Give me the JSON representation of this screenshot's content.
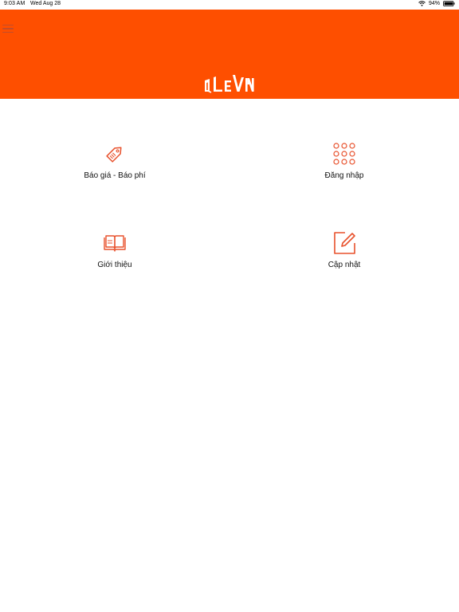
{
  "status_bar": {
    "time": "9:03 AM",
    "date": "Wed Aug 28",
    "battery": "94%"
  },
  "header": {
    "background_color": "#fe4f00",
    "menu_icon": "hamburger-menu-icon",
    "logo_text": "QLEVN"
  },
  "accent_color": "#e8512c",
  "menu": {
    "items": [
      {
        "label": "Báo giá - Báo phí",
        "icon": "price-tag-icon"
      },
      {
        "label": "Đăng nhập",
        "icon": "keypad-grid-icon"
      },
      {
        "label": "Giới thiệu",
        "icon": "open-book-icon"
      },
      {
        "label": "Cập nhật",
        "icon": "edit-square-icon"
      }
    ]
  }
}
